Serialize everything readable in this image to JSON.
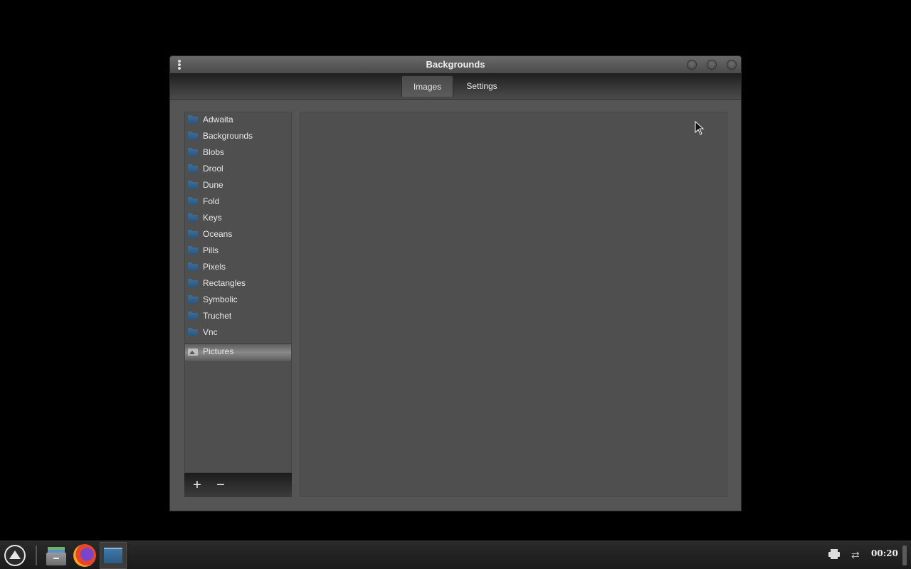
{
  "window": {
    "title": "Backgrounds",
    "tabs": [
      {
        "label": "Images",
        "active": true
      },
      {
        "label": "Settings",
        "active": false
      }
    ]
  },
  "sidebar": {
    "items": [
      {
        "label": "Adwaita",
        "icon": "folder-icon"
      },
      {
        "label": "Backgrounds",
        "icon": "folder-icon"
      },
      {
        "label": "Blobs",
        "icon": "folder-icon"
      },
      {
        "label": "Drool",
        "icon": "folder-icon"
      },
      {
        "label": "Dune",
        "icon": "folder-icon"
      },
      {
        "label": "Fold",
        "icon": "folder-icon"
      },
      {
        "label": "Keys",
        "icon": "folder-icon"
      },
      {
        "label": "Oceans",
        "icon": "folder-icon"
      },
      {
        "label": "Pills",
        "icon": "folder-icon"
      },
      {
        "label": "Pixels",
        "icon": "folder-icon"
      },
      {
        "label": "Rectangles",
        "icon": "folder-icon"
      },
      {
        "label": "Symbolic",
        "icon": "folder-icon"
      },
      {
        "label": "Truchet",
        "icon": "folder-icon"
      },
      {
        "label": "Vnc",
        "icon": "folder-icon"
      }
    ],
    "pictures": {
      "label": "Pictures",
      "icon": "pictures-icon",
      "selected": true
    },
    "toolbar": {
      "add_label": "+",
      "remove_label": "−"
    }
  },
  "taskbar": {
    "clock": "00:20",
    "apps": [
      "file-manager-icon",
      "firefox-icon",
      "backgrounds-app-icon"
    ]
  }
}
